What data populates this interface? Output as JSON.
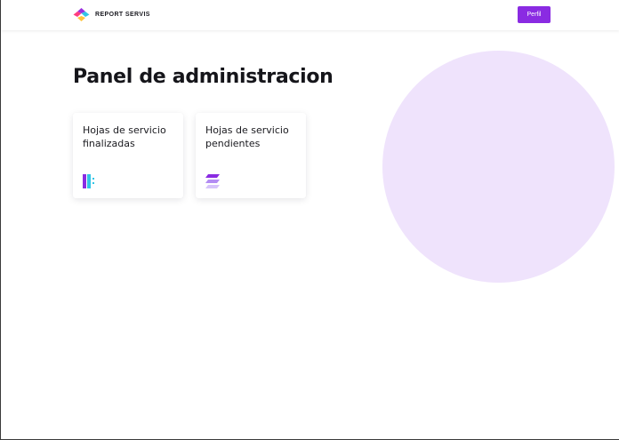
{
  "header": {
    "brand_name": "REPORT SERVIS",
    "brand_logo_icon": "diamond-logo-icon",
    "profile_button_label": "Perfil"
  },
  "main": {
    "title": "Panel de administracion",
    "cards": [
      {
        "label": "Hojas de servicio finalizadas",
        "icon": "columns-icon"
      },
      {
        "label": "Hojas de servicio pendientes",
        "icon": "layers-icon"
      }
    ]
  },
  "colors": {
    "accent": "#8a2be2",
    "decorative_circle": "#efe3fc",
    "logo_purple": "#9b2fe0",
    "logo_pink": "#ff3d7f",
    "logo_cyan": "#32c5e6",
    "logo_yellow": "#ffc53d"
  }
}
